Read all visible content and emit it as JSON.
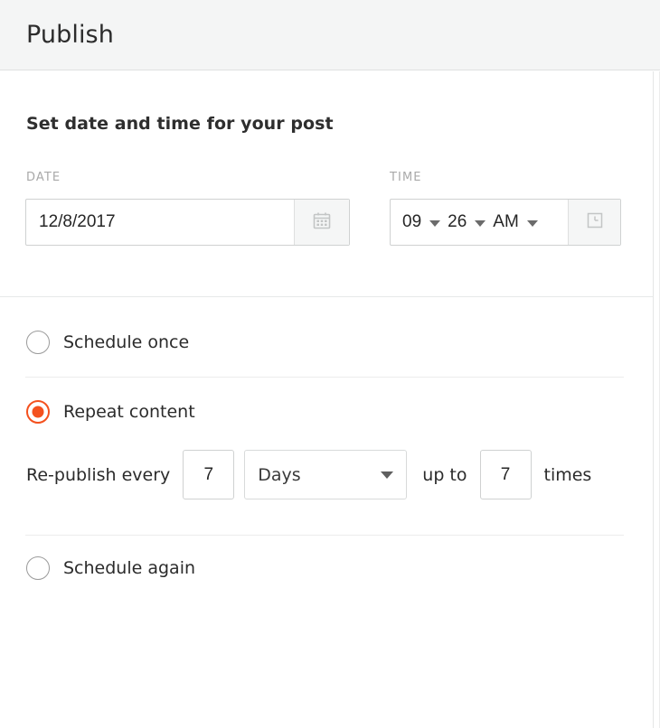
{
  "header": {
    "title": "Publish"
  },
  "datetime_section": {
    "heading": "Set date and time for your post",
    "date": {
      "label": "DATE",
      "value": "12/8/2017",
      "picker_icon": "calendar-icon"
    },
    "time": {
      "label": "TIME",
      "hour": "09",
      "minute": "26",
      "meridiem": "AM",
      "picker_icon": "clock-icon"
    }
  },
  "schedule_options": {
    "once": {
      "label": "Schedule once",
      "selected": false
    },
    "repeat": {
      "label": "Repeat content",
      "selected": true,
      "settings": {
        "prefix_text": "Re-publish every",
        "interval_value": "7",
        "unit_value": "Days",
        "middle_text": "up to",
        "count_value": "7",
        "suffix_text": "times"
      }
    },
    "again": {
      "label": "Schedule again",
      "selected": false
    }
  },
  "colors": {
    "accent": "#f4511e",
    "header_bg": "#f4f5f5",
    "text": "#2b2b2b",
    "muted_label": "#a9a9a9",
    "border": "#cfd1d1"
  }
}
